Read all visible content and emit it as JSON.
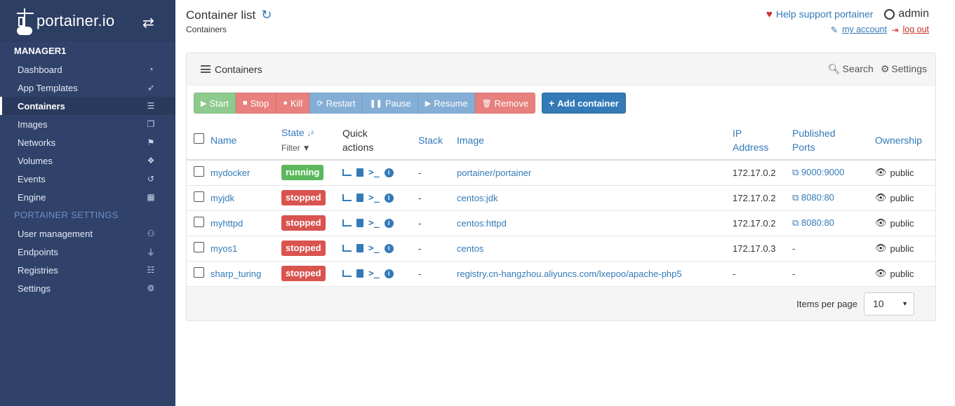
{
  "brand": {
    "logo_text": "portainer.io"
  },
  "sidebar": {
    "endpoint": "MANAGER1",
    "items": [
      {
        "label": "Dashboard",
        "icon": "dashboard-icon",
        "glyph": "◔"
      },
      {
        "label": "App Templates",
        "icon": "rocket-icon",
        "glyph": "➶"
      },
      {
        "label": "Containers",
        "icon": "server-icon",
        "glyph": "☰",
        "active": true
      },
      {
        "label": "Images",
        "icon": "clone-icon",
        "glyph": "❐"
      },
      {
        "label": "Networks",
        "icon": "sitemap-icon",
        "glyph": "⚑"
      },
      {
        "label": "Volumes",
        "icon": "cubes-icon",
        "glyph": "❖"
      },
      {
        "label": "Events",
        "icon": "history-icon",
        "glyph": "↺"
      },
      {
        "label": "Engine",
        "icon": "th-icon",
        "glyph": "▦"
      }
    ],
    "settings_section": "PORTAINER SETTINGS",
    "settings_items": [
      {
        "label": "User management",
        "icon": "users-icon",
        "glyph": "⚇"
      },
      {
        "label": "Endpoints",
        "icon": "plug-icon",
        "glyph": "⏚"
      },
      {
        "label": "Registries",
        "icon": "database-icon",
        "glyph": "☷"
      },
      {
        "label": "Settings",
        "icon": "cogs-icon",
        "glyph": "⚙"
      }
    ]
  },
  "header": {
    "title": "Container list",
    "subtitle": "Containers",
    "help_link": "Help support portainer",
    "username": "admin",
    "my_account": "my account",
    "log_out": "log out"
  },
  "widget": {
    "title": "Containers",
    "search_label": "Search",
    "settings_label": "Settings"
  },
  "toolbar": {
    "start": "Start",
    "stop": "Stop",
    "kill": "Kill",
    "restart": "Restart",
    "pause": "Pause",
    "resume": "Resume",
    "remove": "Remove",
    "add_container": "Add container"
  },
  "table": {
    "columns": {
      "name": "Name",
      "state": "State",
      "filter": "Filter",
      "quick_actions_1": "Quick",
      "quick_actions_2": "actions",
      "stack": "Stack",
      "image": "Image",
      "ip_1": "IP",
      "ip_2": "Address",
      "ports_1": "Published",
      "ports_2": "Ports",
      "ownership": "Ownership"
    },
    "rows": [
      {
        "name": "mydocker",
        "state": "running",
        "stack": "-",
        "image": "portainer/portainer",
        "ip": "172.17.0.2",
        "port": "9000:9000",
        "ownership": "public"
      },
      {
        "name": "myjdk",
        "state": "stopped",
        "stack": "-",
        "image": "centos:jdk",
        "ip": "172.17.0.2",
        "port": "8080:80",
        "ownership": "public"
      },
      {
        "name": "myhttpd",
        "state": "stopped",
        "stack": "-",
        "image": "centos:httpd",
        "ip": "172.17.0.2",
        "port": "8080:80",
        "ownership": "public"
      },
      {
        "name": "myos1",
        "state": "stopped",
        "stack": "-",
        "image": "centos",
        "ip": "172.17.0.3",
        "port": "-",
        "ownership": "public"
      },
      {
        "name": "sharp_turing",
        "state": "stopped",
        "stack": "-",
        "image": "registry.cn-hangzhou.aliyuncs.com/lxepoo/apache-php5",
        "ip": "-",
        "port": "-",
        "ownership": "public"
      }
    ]
  },
  "pagination": {
    "items_per_page_label": "Items per page",
    "items_per_page_value": "10"
  },
  "colors": {
    "sidebar_bg": "#30426a",
    "primary": "#337ab7",
    "running": "#5cb85c",
    "stopped": "#d9534f"
  }
}
